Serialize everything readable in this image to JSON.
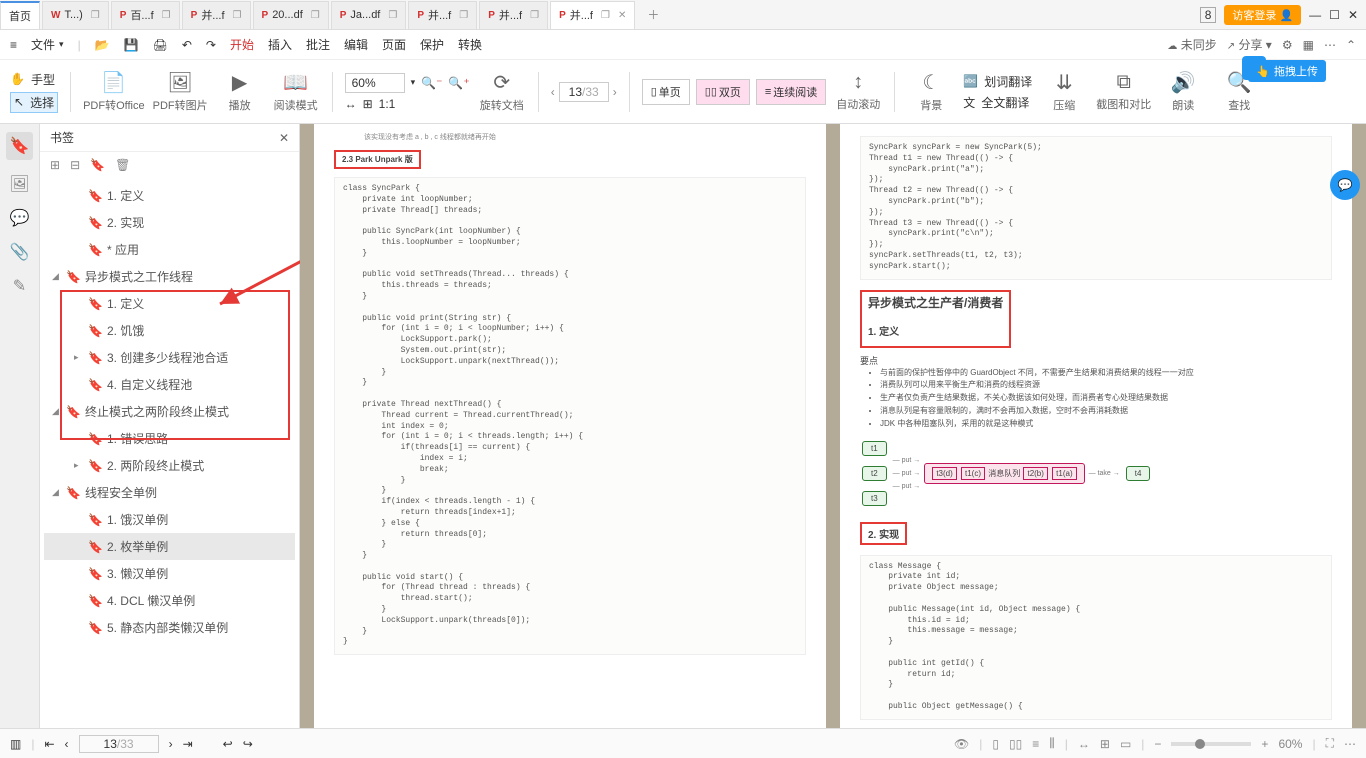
{
  "tabs": {
    "home": "首页",
    "items": [
      {
        "label": "T...)"
      },
      {
        "label": "百...f"
      },
      {
        "label": "并...f"
      },
      {
        "label": "20...df"
      },
      {
        "label": "Ja...df"
      },
      {
        "label": "并...f"
      },
      {
        "label": "并...f"
      },
      {
        "label": "并...f"
      }
    ],
    "counter": "8",
    "login": "访客登录"
  },
  "menu": {
    "file": "文件",
    "items": [
      "开始",
      "插入",
      "批注",
      "编辑",
      "页面",
      "保护",
      "转换"
    ],
    "right": [
      "未同步",
      "分享"
    ]
  },
  "toolbar": {
    "hand": "手型",
    "select": "选择",
    "pdf2office": "PDF转Office",
    "pdf2img": "PDF转图片",
    "play": "播放",
    "readmode": "阅读模式",
    "zoom": "60%",
    "rotate": "旋转文档",
    "page_current": "13",
    "page_total": "/33",
    "single": "单页",
    "double": "双页",
    "cont": "连续阅读",
    "autoscroll": "自动滚动",
    "bg": "背景",
    "dict": "划词翻译",
    "trans": "全文翻译",
    "compress": "压缩",
    "compare": "截图和对比",
    "read_aloud": "朗读",
    "find": "查找"
  },
  "floats": {
    "drag": "拖拽上传"
  },
  "sidebar": {
    "title": "书签",
    "items": [
      {
        "label": "1. 定义",
        "lvl": 2
      },
      {
        "label": "2. 实现",
        "lvl": 2
      },
      {
        "label": "* 应用",
        "lvl": 2
      },
      {
        "label": "异步模式之工作线程",
        "lvl": 1,
        "exp": true
      },
      {
        "label": "1. 定义",
        "lvl": 2
      },
      {
        "label": "2. 饥饿",
        "lvl": 2
      },
      {
        "label": "3. 创建多少线程池合适",
        "lvl": 2,
        "c": true
      },
      {
        "label": "4. 自定义线程池",
        "lvl": 2
      },
      {
        "label": "终止模式之两阶段终止模式",
        "lvl": 1,
        "exp": true
      },
      {
        "label": "1. 错误思路",
        "lvl": 2
      },
      {
        "label": "2. 两阶段终止模式",
        "lvl": 2,
        "c": true
      },
      {
        "label": "线程安全单例",
        "lvl": 1,
        "exp": true
      },
      {
        "label": "1. 饿汉单例",
        "lvl": 2
      },
      {
        "label": "2. 枚举单例",
        "lvl": 2,
        "sel": true
      },
      {
        "label": "3. 懒汉单例",
        "lvl": 2
      },
      {
        "label": "4. DCL 懒汉单例",
        "lvl": 2
      },
      {
        "label": "5. 静态内部类懒汉单例",
        "lvl": 2
      }
    ]
  },
  "doc_left": {
    "note": "该实现没有考虑 a , b , c 线程都就绪再开始",
    "heading": "2.3 Park Unpark 版",
    "code": "class SyncPark {\n    private int loopNumber;\n    private Thread[] threads;\n\n    public SyncPark(int loopNumber) {\n        this.loopNumber = loopNumber;\n    }\n\n    public void setThreads(Thread... threads) {\n        this.threads = threads;\n    }\n\n    public void print(String str) {\n        for (int i = 0; i < loopNumber; i++) {\n            LockSupport.park();\n            System.out.print(str);\n            LockSupport.unpark(nextThread());\n        }\n    }\n\n    private Thread nextThread() {\n        Thread current = Thread.currentThread();\n        int index = 0;\n        for (int i = 0; i < threads.length; i++) {\n            if(threads[i] == current) {\n                index = i;\n                break;\n            }\n        }\n        if(index < threads.length - 1) {\n            return threads[index+1];\n        } else {\n            return threads[0];\n        }\n    }\n\n    public void start() {\n        for (Thread thread : threads) {\n            thread.start();\n        }\n        LockSupport.unpark(threads[0]);\n    }\n}"
  },
  "doc_right": {
    "code_top": "SyncPark syncPark = new SyncPark(5);\nThread t1 = new Thread(() -> {\n    syncPark.print(\"a\");\n});\nThread t2 = new Thread(() -> {\n    syncPark.print(\"b\");\n});\nThread t3 = new Thread(() -> {\n    syncPark.print(\"c\\n\");\n});\nsyncPark.setThreads(t1, t2, t3);\nsyncPark.start();",
    "h_async": "异步模式之生产者/消费者",
    "h_def": "1. 定义",
    "bullets_head": "要点",
    "bullets": [
      "与前面的保护性暂停中的 GuardObject 不同，不需要产生结果和消费结果的线程一一对应",
      "消费队列可以用来平衡生产和消费的线程资源",
      "生产者仅负责产生结果数据，不关心数据该如何处理，而消费者专心处理结果数据",
      "消息队列是有容量限制的，满时不会再加入数据，空时不会再消耗数据",
      "JDK 中各种阻塞队列，采用的就是这种模式"
    ],
    "diag": {
      "t1": "t1",
      "t2": "t2",
      "t3": "t3",
      "q": "消息队列",
      "cells": [
        "t3(d)",
        "t1(c)",
        "t2(b)",
        "t1(a)"
      ],
      "t4": "t4",
      "put": "put",
      "take": "take"
    },
    "h_impl": "2. 实现",
    "code_msg": "class Message {\n    private int id;\n    private Object message;\n\n    public Message(int id, Object message) {\n        this.id = id;\n        this.message = message;\n    }\n\n    public int getId() {\n        return id;\n    }\n\n    public Object getMessage() {"
  },
  "status": {
    "pg_cur": "13",
    "pg_total": "/33",
    "zoom": "60%"
  }
}
